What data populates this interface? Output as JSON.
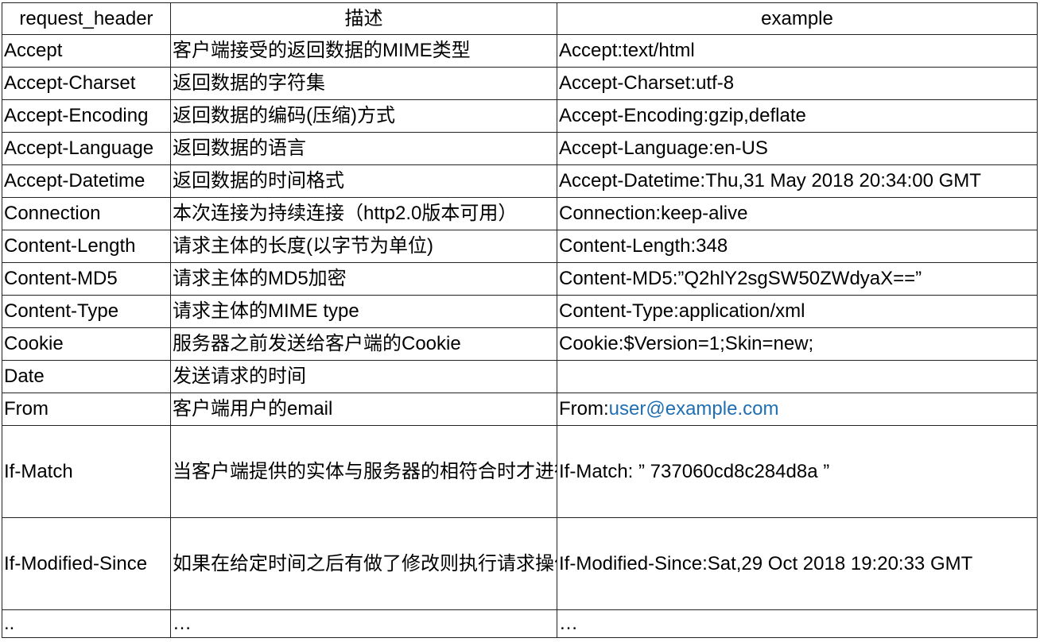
{
  "headers": {
    "col1": "request_header",
    "col2": "描述",
    "col3": "example"
  },
  "rows": [
    {
      "name": "Accept",
      "desc": "客户端接受的返回数据的MIME类型",
      "example": "Accept:text/html"
    },
    {
      "name": "Accept-Charset",
      "desc": "返回数据的字符集",
      "example": "Accept-Charset:utf-8"
    },
    {
      "name": "Accept-Encoding",
      "desc": "返回数据的编码(压缩)方式",
      "example": "Accept-Encoding:gzip,deflate"
    },
    {
      "name": "Accept-Language",
      "desc": "返回数据的语言",
      "example": "Accept-Language:en-US"
    },
    {
      "name": "Accept-Datetime",
      "desc": "返回数据的时间格式",
      "example": "Accept-Datetime:Thu,31 May 2018 20:34:00 GMT"
    },
    {
      "name": "Connection",
      "desc": "本次连接为持续连接（http2.0版本可用）",
      "example": "Connection:keep-alive"
    },
    {
      "name": "Content-Length",
      "desc": "请求主体的长度(以字节为单位)",
      "example": "Content-Length:348"
    },
    {
      "name": "Content-MD5",
      "desc": "请求主体的MD5加密",
      "example": "Content-MD5:”Q2hlY2sgSW50ZWdyaX==”"
    },
    {
      "name": "Content-Type",
      "desc": "请求主体的MIME type",
      "example": "Content-Type:application/xml"
    },
    {
      "name": "Cookie",
      "desc": "服务器之前发送给客户端的Cookie",
      "example": "Cookie:$Version=1;Skin=new;"
    },
    {
      "name": "Date",
      "desc": "发送请求的时间",
      "example": ""
    },
    {
      "name": "From",
      "desc": "客户端用户的email",
      "example_prefix": "From:",
      "example_link": "user@example.com"
    },
    {
      "name": "If-Match",
      "desc": "当客户端提供的实体与服务器的相符合时才进行请求的操作，如PUT某个数据在之前没有修改的情况下",
      "example": "If-Match: ” 737060cd8c284d8a ”"
    },
    {
      "name": "If-Modified-Since",
      "desc": "如果在给定时间之后有做了修改则执行请求操作(为了节约下载已经下载且不需更新的内容)",
      "example": "If-Modified-Since:Sat,29 Oct 2018 19:20:33 GMT"
    },
    {
      "name": "..",
      "desc": "…",
      "example": "…"
    }
  ]
}
